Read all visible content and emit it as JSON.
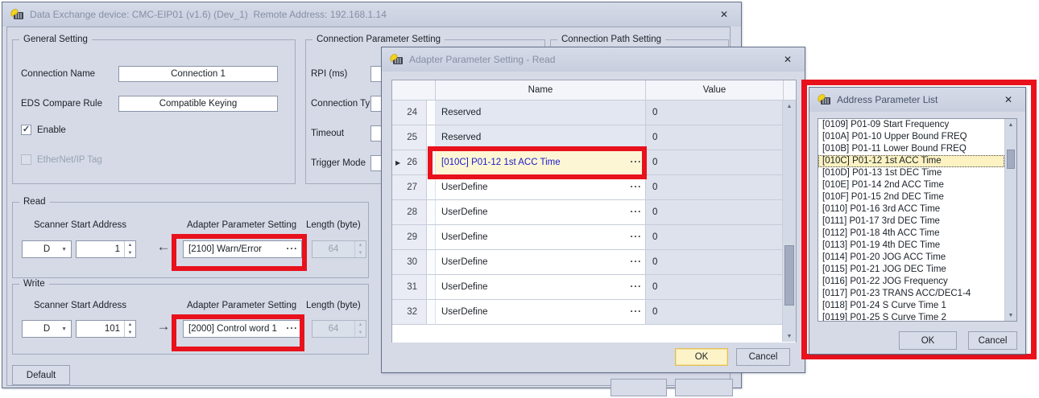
{
  "colors": {
    "annotation": "#e8111c",
    "selection": "#fcf6d5",
    "list_selection": "#fdf3c2",
    "link": "#1a1ac8",
    "ok_focus_bg": "#fcf3c9",
    "ok_focus_border": "#e2bf55"
  },
  "main_window": {
    "title": "Data Exchange device: CMC-EIP01 (v1.6) (Dev_1)  Remote Address: 192.168.1.14",
    "close_label": "✕",
    "general": {
      "legend": "General Setting",
      "connection_name_label": "Connection Name",
      "connection_name_value": "Connection 1",
      "eds_label": "EDS Compare Rule",
      "eds_value": "Compatible Keying",
      "enable_label": "Enable",
      "ethernet_tag_label": "EtherNet/IP Tag"
    },
    "conn_param": {
      "legend": "Connection Parameter Setting",
      "rows": [
        "RPI (ms)",
        "Connection Type",
        "Timeout",
        "Trigger Mode"
      ]
    },
    "conn_path": {
      "legend": "Connection Path Setting"
    },
    "read": {
      "legend": "Read",
      "scanner_label": "Scanner Start Address",
      "adapter_label": "Adapter Parameter Setting",
      "length_label": "Length (byte)",
      "device": "D",
      "address": "1",
      "arrow": "←",
      "adapter_value": "[2100] Warn/Error",
      "ellipsis": "···",
      "length_value": "64"
    },
    "write": {
      "legend": "Write",
      "scanner_label": "Scanner Start Address",
      "adapter_label": "Adapter Parameter Setting",
      "length_label": "Length (byte)",
      "device": "D",
      "address": "101",
      "arrow": "→",
      "adapter_value": "[2000] Control word 1",
      "ellipsis": "···",
      "length_value": "64"
    },
    "default_button": "Default"
  },
  "adapter_dialog": {
    "title": "Adapter Parameter Setting - Read",
    "close_label": "✕",
    "columns": [
      "Name",
      "Value"
    ],
    "rows": [
      {
        "num": "24",
        "name": "Reserved",
        "value": "0",
        "editable": false,
        "selected": false
      },
      {
        "num": "25",
        "name": "Reserved",
        "value": "0",
        "editable": false,
        "selected": false
      },
      {
        "num": "26",
        "name": "[010C] P01-12 1st ACC Time",
        "value": "0",
        "editable": true,
        "selected": true
      },
      {
        "num": "27",
        "name": "UserDefine",
        "value": "0",
        "editable": true,
        "selected": false
      },
      {
        "num": "28",
        "name": "UserDefine",
        "value": "0",
        "editable": true,
        "selected": false
      },
      {
        "num": "29",
        "name": "UserDefine",
        "value": "0",
        "editable": true,
        "selected": false
      },
      {
        "num": "30",
        "name": "UserDefine",
        "value": "0",
        "editable": true,
        "selected": false
      },
      {
        "num": "31",
        "name": "UserDefine",
        "value": "0",
        "editable": true,
        "selected": false
      },
      {
        "num": "32",
        "name": "UserDefine",
        "value": "0",
        "editable": true,
        "selected": false
      }
    ],
    "ellipsis": "···",
    "ok_button": "OK",
    "cancel_button": "Cancel"
  },
  "address_dialog": {
    "title": "Address Parameter List",
    "close_label": "✕",
    "items": [
      "[0109] P01-09 Start Frequency",
      "[010A] P01-10 Upper Bound FREQ",
      "[010B] P01-11 Lower Bound FREQ",
      "[010C] P01-12 1st ACC Time",
      "[010D] P01-13 1st DEC Time",
      "[010E] P01-14 2nd ACC Time",
      "[010F] P01-15 2nd DEC Time",
      "[0110] P01-16 3rd ACC Time",
      "[0111] P01-17 3rd DEC Time",
      "[0112] P01-18 4th ACC Time",
      "[0113] P01-19 4th DEC Time",
      "[0114] P01-20 JOG ACC Time",
      "[0115] P01-21 JOG DEC Time",
      "[0116] P01-22 JOG Frequency",
      "[0117] P01-23 TRANS ACC/DEC1-4",
      "[0118] P01-24 S Curve Time 1",
      "[0119] P01-25 S Curve Time 2"
    ],
    "selected_index": 3,
    "ok_button": "OK",
    "cancel_button": "Cancel"
  }
}
